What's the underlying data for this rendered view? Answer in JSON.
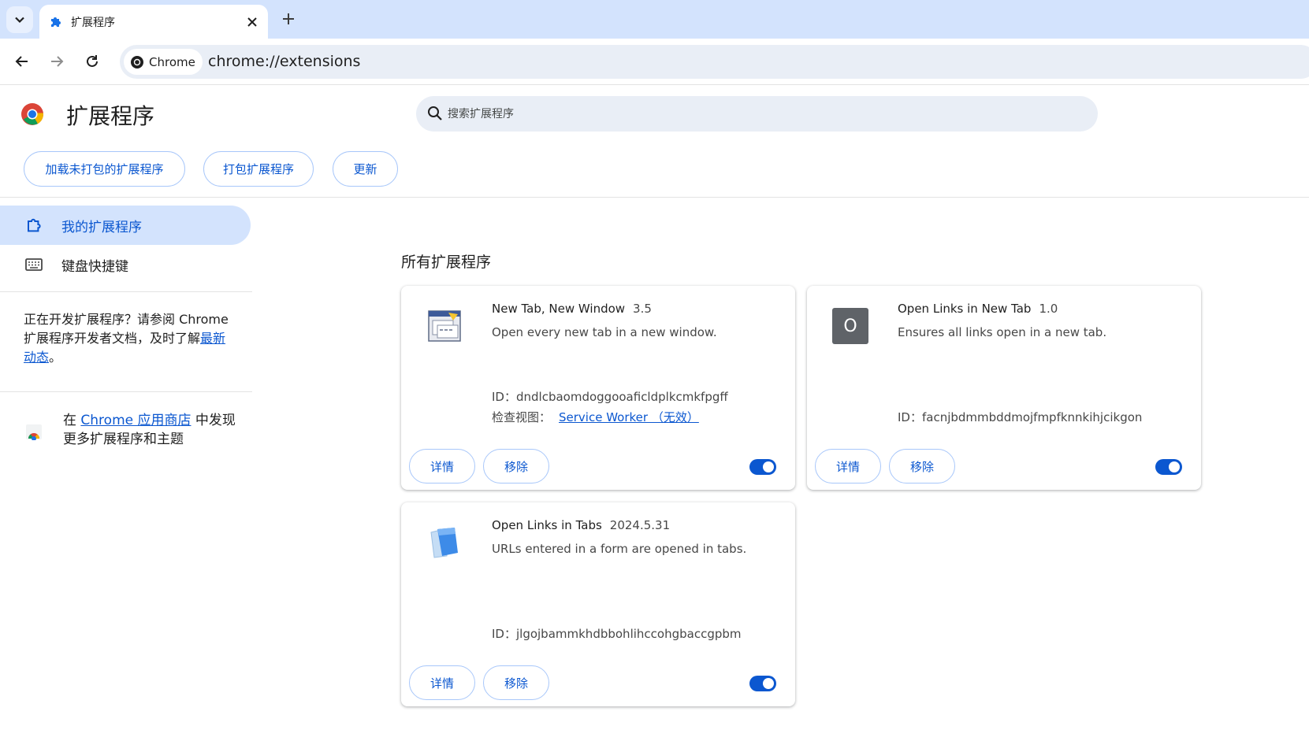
{
  "tabstrip": {
    "tab_title": "扩展程序",
    "icons": [
      "chevron-down-icon",
      "puzzle-icon",
      "close-icon",
      "plus-icon"
    ]
  },
  "toolbar": {
    "site_chip_label": "Chrome",
    "url": "chrome://extensions"
  },
  "header": {
    "title": "扩展程序",
    "search_placeholder": "搜索扩展程序",
    "buttons": {
      "load_unpacked": "加载未打包的扩展程序",
      "pack": "打包扩展程序",
      "update": "更新"
    }
  },
  "sidebar": {
    "items": [
      {
        "label": "我的扩展程序",
        "icon": "extension-icon",
        "active": true
      },
      {
        "label": "键盘快捷键",
        "icon": "keyboard-icon",
        "active": false
      }
    ],
    "dev_text_before": "正在开发扩展程序？请参阅 Chrome 扩展程序开发者文档，及时了解",
    "dev_link": "最新动态",
    "dev_text_after": "。",
    "store_prefix": "在 ",
    "store_link": "Chrome 应用商店",
    "store_suffix": " 中发现更多扩展程序和主题"
  },
  "main": {
    "section_title": "所有扩展程序",
    "extensions": [
      {
        "name": "New Tab, New Window",
        "version": "3.5",
        "description": "Open every new tab in a new window.",
        "id_label": "ID：",
        "id": "dndlcbaomdoggooaficldplkcmkfpgff",
        "inspect_label": "检查视图：",
        "inspect_link": "Service Worker （无效）",
        "details_label": "详情",
        "remove_label": "移除",
        "enabled": true
      },
      {
        "name": "Open Links in New Tab",
        "version": "1.0",
        "description": "Ensures all links open in a new tab.",
        "id_label": "ID：",
        "id": "facnjbdmmbddmojfmpfknnkihjcikgon",
        "icon_letter": "O",
        "details_label": "详情",
        "remove_label": "移除",
        "enabled": true
      },
      {
        "name": "Open Links in Tabs",
        "version": "2024.5.31",
        "description": "URLs entered in a form are opened in tabs.",
        "id_label": "ID：",
        "id": "jlgojbammkhdbbohlihccohgbaccgpbm",
        "details_label": "详情",
        "remove_label": "移除",
        "enabled": true
      }
    ]
  },
  "colors": {
    "accent": "#0b57d0",
    "tabstrip_bg": "#d3e3fd",
    "omnibox_bg": "#e9eef6",
    "button_border": "#a8c7fa"
  }
}
